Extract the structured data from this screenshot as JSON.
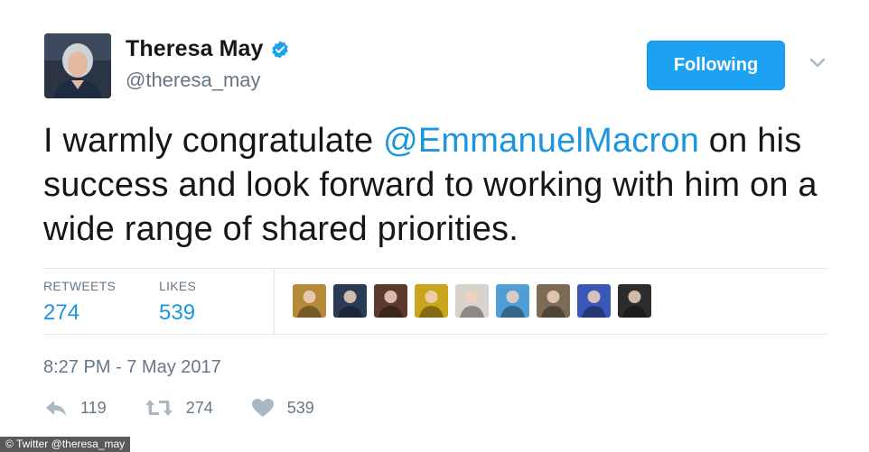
{
  "author": {
    "name": "Theresa May",
    "handle": "@theresa_may",
    "verified": true
  },
  "follow_button": {
    "label": "Following"
  },
  "tweet": {
    "text_before": "I warmly congratulate ",
    "mention": "@EmmanuelMacron",
    "text_after": " on his success and look forward to working with him on a wide range of shared priorities."
  },
  "stats": {
    "retweets_label": "RETWEETS",
    "retweets_value": "274",
    "likes_label": "LIKES",
    "likes_value": "539"
  },
  "likers": [
    {
      "name": "liker-avatar-1",
      "color": "#b58a3a"
    },
    {
      "name": "liker-avatar-2",
      "color": "#2c3b55"
    },
    {
      "name": "liker-avatar-3",
      "color": "#5a3a2a"
    },
    {
      "name": "liker-avatar-4",
      "color": "#c9a51c"
    },
    {
      "name": "liker-avatar-5",
      "color": "#d7d2cb"
    },
    {
      "name": "liker-avatar-6",
      "color": "#4f9fd6"
    },
    {
      "name": "liker-avatar-7",
      "color": "#7d6a57"
    },
    {
      "name": "liker-avatar-8",
      "color": "#3a58b8"
    },
    {
      "name": "liker-avatar-9",
      "color": "#2d2d2d"
    }
  ],
  "timestamp": "8:27 PM - 7 May 2017",
  "actions": {
    "reply_count": "119",
    "retweet_count": "274",
    "like_count": "539"
  },
  "credit": "© Twitter @theresa_may",
  "colors": {
    "accent": "#1da1f2",
    "link": "#1b95e0",
    "muted": "#657786",
    "divider": "#e1e8ed"
  }
}
